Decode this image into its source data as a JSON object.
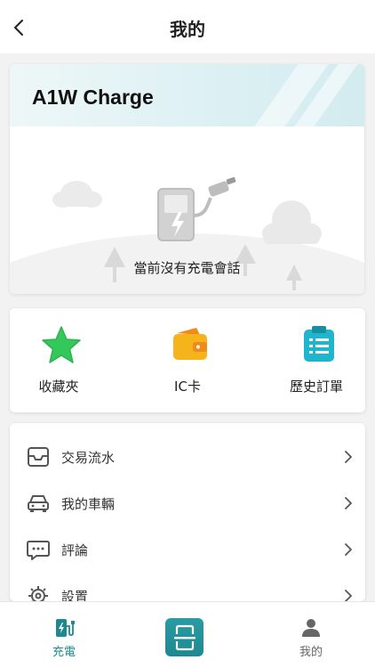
{
  "header": {
    "title": "我的"
  },
  "session_card": {
    "brand": "A1W Charge",
    "empty_text": "當前沒有充電會話"
  },
  "quick_actions": [
    {
      "label": "收藏夾",
      "icon": "star-icon"
    },
    {
      "label": "IC卡",
      "icon": "wallet-icon"
    },
    {
      "label": "歷史訂單",
      "icon": "clipboard-icon"
    }
  ],
  "menu": [
    {
      "label": "交易流水",
      "icon": "transactions-icon"
    },
    {
      "label": "我的車輛",
      "icon": "car-icon"
    },
    {
      "label": "評論",
      "icon": "comment-icon"
    },
    {
      "label": "設置",
      "icon": "gear-icon"
    }
  ],
  "tabbar": {
    "tabs": [
      {
        "label": "充電",
        "icon": "charging-icon",
        "active": true
      },
      {
        "label": "我的",
        "icon": "person-icon",
        "active": false
      }
    ],
    "scan_icon": "scan-icon"
  },
  "colors": {
    "accent": "#1e8891",
    "star": "#34c75a",
    "wallet": "#f5b31c",
    "clipboard": "#1fb5cc",
    "inactive_tab": "#666666"
  }
}
